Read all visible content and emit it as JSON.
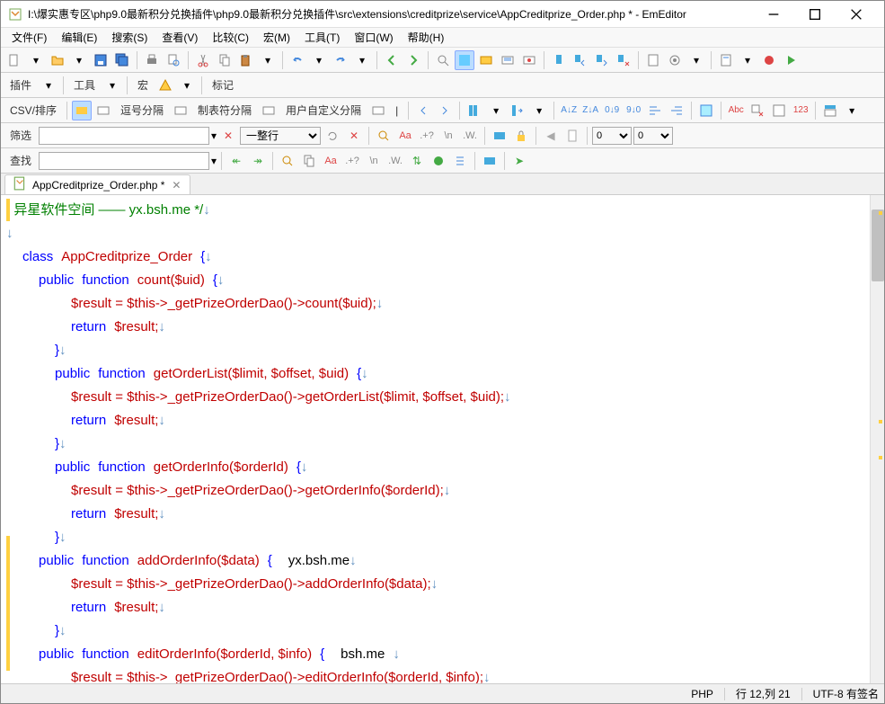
{
  "window": {
    "title": "I:\\爆实惠专区\\php9.0最新积分兑换插件\\php9.0最新积分兑换插件\\src\\extensions\\creditprize\\service\\AppCreditprize_Order.php * - EmEditor"
  },
  "menu": {
    "file": "文件(F)",
    "edit": "编辑(E)",
    "search": "搜索(S)",
    "view": "查看(V)",
    "compare": "比较(C)",
    "macro": "宏(M)",
    "tools": "工具(T)",
    "window": "窗口(W)",
    "help": "帮助(H)"
  },
  "toolbar2": {
    "plugin": "插件",
    "tools": "工具",
    "macro": "宏",
    "mark": "标记"
  },
  "csv": {
    "label": "CSV/排序",
    "comma": "逗号分隔",
    "tab": "制表符分隔",
    "user": "用户自定义分隔"
  },
  "filter": {
    "label": "筛选",
    "whole_line": "一整行",
    "num1": "0",
    "num2": "0"
  },
  "find": {
    "label": "查找"
  },
  "tab": {
    "name": "AppCreditprize_Order.php *"
  },
  "code": {
    "l1_comment": "异星软件空间 —— yx.bsh.me */",
    "l3_class": "class",
    "l3_name": "AppCreditprize_Order",
    "l4_pub": "public",
    "l4_func": "function",
    "l4_name": "count",
    "l4_param": "($uid)",
    "l5_a": "$result = $this->_getPrizeOrderDao()->",
    "l5_m": "count",
    "l5_b": "($uid);",
    "l6_ret": "return",
    "l6_v": "$result;",
    "l8_pub": "public",
    "l8_func": "function",
    "l8_name": "getOrderList",
    "l8_param": "($limit, $offset, $uid)",
    "l9_a": "$result = $this->_getPrizeOrderDao()->",
    "l9_m": "getOrderList",
    "l9_b": "($limit, $offset, $uid);",
    "l10_ret": "return",
    "l10_v": "$result;",
    "l12_pub": "public",
    "l12_func": "function",
    "l12_name": "getOrderInfo",
    "l12_param": "($orderId)",
    "l13_a": "$result = $this->_getPrizeOrderDao()->",
    "l13_m": "getOrderInfo",
    "l13_b": "($orderId);",
    "l14_ret": "return",
    "l14_v": "$result;",
    "l16_pub": "public",
    "l16_func": "function",
    "l16_name": "addOrderInfo",
    "l16_param": "($data)",
    "l16_c": "yx.bsh.me",
    "l17_a": "$result = $this->_getPrizeOrderDao()->",
    "l17_m": "addOrderInfo",
    "l17_b": "($data);",
    "l18_ret": "return",
    "l18_v": "$result;",
    "l20_pub": "public",
    "l20_func": "function",
    "l20_name": "editOrderInfo",
    "l20_param": "($orderId, $info)",
    "l20_c": "bsh.me",
    "l21_a": "$result = $this->_getPrizeOrderDao()->",
    "l21_m": "editOrderInfo",
    "l21_b": "($orderId, $info);"
  },
  "status": {
    "lang": "PHP",
    "pos": "行 12,列 21",
    "enc": "UTF-8 有签名"
  }
}
